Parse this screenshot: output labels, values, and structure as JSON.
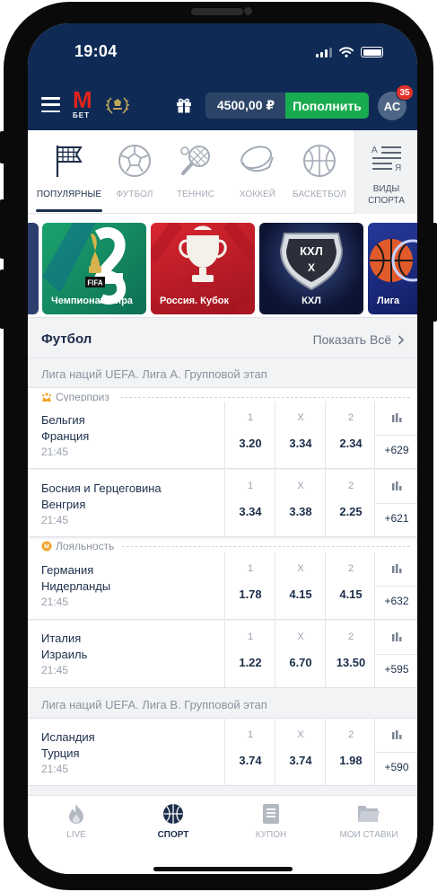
{
  "status": {
    "time": "19:04"
  },
  "header": {
    "logo_letter": "М",
    "logo_text": "БЕТ",
    "balance": "4500,00 ₽",
    "topup_label": "Пополнить",
    "avatar_initials": "АС",
    "notifications": "35"
  },
  "sports_tabs": [
    {
      "label": "ПОПУЛЯРНЫЕ",
      "icon": "flag-icon",
      "active": true
    },
    {
      "label": "ФУТБОЛ",
      "icon": "soccer-ball-icon"
    },
    {
      "label": "ТЕННИС",
      "icon": "tennis-racket-icon"
    },
    {
      "label": "ХОККЕЙ",
      "icon": "hockey-puck-icon"
    },
    {
      "label": "БАСКЕТБОЛ",
      "icon": "basketball-icon"
    }
  ],
  "kinds_label_line1": "ВИДЫ",
  "kinds_label_line2": "СПОРТА",
  "kinds_icon_letters": {
    "a": "А",
    "ya": "Я"
  },
  "banners": [
    {
      "caption": "Чемпионат мира",
      "badge": "FIFA",
      "color": "#1a9a6a"
    },
    {
      "caption": "Россия. Кубок",
      "color": "#c81e2a"
    },
    {
      "caption": "КХЛ",
      "badge": "КХЛ",
      "color": "#101a3c"
    },
    {
      "caption": "Лига",
      "color": "#1d2f7a"
    }
  ],
  "section": {
    "title": "Футбол",
    "show_all": "Показать Всё"
  },
  "leagues": [
    "Лига наций UEFA. Лига А. Групповой этап",
    "Лига наций UEFA. Лига B. Групповой этап"
  ],
  "promos": [
    "Суперприз",
    "Лояльность"
  ],
  "odds_headers": [
    "1",
    "X",
    "2"
  ],
  "matches": [
    {
      "home": "Бельгия",
      "away": "Франция",
      "time": "21:45",
      "o1": "3.20",
      "ox": "3.34",
      "o2": "2.34",
      "more": "+629"
    },
    {
      "home": "Босния и Герцеговина",
      "away": "Венгрия",
      "time": "21:45",
      "o1": "3.34",
      "ox": "3.38",
      "o2": "2.25",
      "more": "+621"
    },
    {
      "home": "Германия",
      "away": "Нидерланды",
      "time": "21:45",
      "o1": "1.78",
      "ox": "4.15",
      "o2": "4.15",
      "more": "+632"
    },
    {
      "home": "Италия",
      "away": "Израиль",
      "time": "21:45",
      "o1": "1.22",
      "ox": "6.70",
      "o2": "13.50",
      "more": "+595"
    },
    {
      "home": "Исландия",
      "away": "Турция",
      "time": "21:45",
      "o1": "3.74",
      "ox": "3.74",
      "o2": "1.98",
      "more": "+590"
    }
  ],
  "bottom_nav": [
    {
      "label": "LIVE",
      "icon": "fire-icon"
    },
    {
      "label": "СПОРТ",
      "icon": "sport-ball-icon",
      "active": true
    },
    {
      "label": "КУПОН",
      "icon": "coupon-icon"
    },
    {
      "label": "МОИ СТАВКИ",
      "icon": "folder-icon"
    }
  ],
  "colors": {
    "header_bg": "#0e2a55",
    "topup_green": "#18ab4f",
    "brand_red": "#e2231a",
    "text_dark": "#1c2e4a"
  }
}
